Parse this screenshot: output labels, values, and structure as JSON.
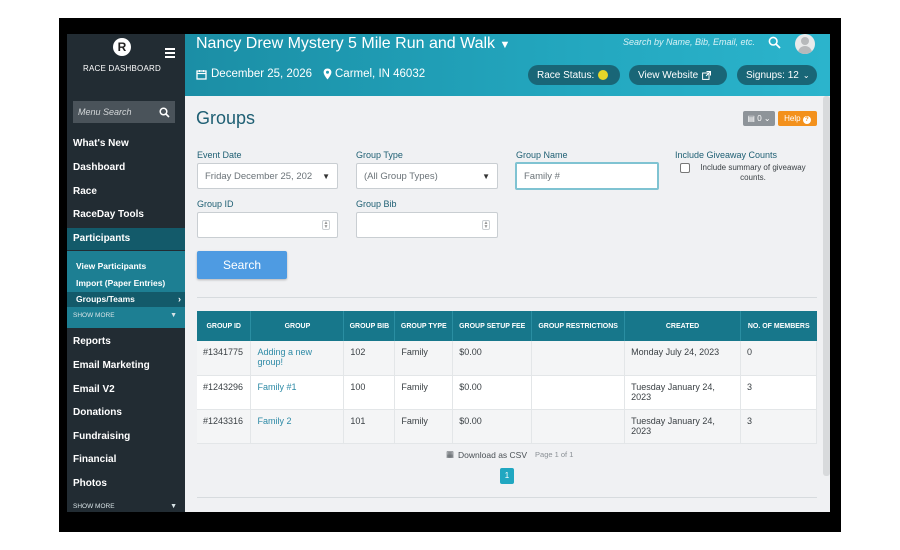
{
  "sidebar": {
    "logo_letter": "R",
    "logo_text": "RACE DASHBOARD",
    "menu_search_placeholder": "Menu Search",
    "items_top": [
      "What's New",
      "Dashboard",
      "Race",
      "RaceDay Tools"
    ],
    "active_item": "Participants",
    "sub_items": [
      "View Participants",
      "Import (Paper Entries)",
      "Groups/Teams"
    ],
    "show_more_1": "SHOW MORE",
    "items_bottom": [
      "Reports",
      "Email Marketing",
      "Email V2",
      "Donations",
      "Fundraising",
      "Financial",
      "Photos"
    ],
    "show_more_2": "SHOW MORE"
  },
  "header": {
    "event_title": "Nancy Drew Mystery 5 Mile Run and Walk",
    "search_placeholder": "Search by Name, Bib, Email, etc.",
    "date": "December 25, 2026",
    "location": "Carmel, IN 46032",
    "race_status_label": "Race Status:",
    "view_website_label": "View Website",
    "signups_label": "Signups: 12"
  },
  "main": {
    "title": "Groups",
    "count_button": "0",
    "help_button": "Help",
    "filters": {
      "event_date_label": "Event Date",
      "event_date_value": "Friday December 25, 202",
      "group_type_label": "Group Type",
      "group_type_value": "(All Group Types)",
      "group_name_label": "Group Name",
      "group_name_value": "Family #",
      "giveaway_label": "Include Giveaway Counts",
      "giveaway_desc": "Include summary of giveaway counts.",
      "group_id_label": "Group ID",
      "group_bib_label": "Group Bib"
    },
    "search_button": "Search"
  },
  "table": {
    "headers": [
      "GROUP ID",
      "GROUP",
      "GROUP BIB",
      "GROUP TYPE",
      "GROUP SETUP FEE",
      "GROUP RESTRICTIONS",
      "CREATED",
      "NO. OF MEMBERS"
    ],
    "rows": [
      {
        "id": "#1341775",
        "group": "Adding a new group!",
        "bib": "102",
        "type": "Family",
        "fee": "$0.00",
        "restrictions": "",
        "created": "Monday July 24, 2023",
        "members": "0"
      },
      {
        "id": "#1243296",
        "group": "Family #1",
        "bib": "100",
        "type": "Family",
        "fee": "$0.00",
        "restrictions": "",
        "created": "Tuesday January 24, 2023",
        "members": "3"
      },
      {
        "id": "#1243316",
        "group": "Family 2",
        "bib": "101",
        "type": "Family",
        "fee": "$0.00",
        "restrictions": "",
        "created": "Tuesday January 24, 2023",
        "members": "3"
      }
    ]
  },
  "footer": {
    "download_csv": "Download as CSV",
    "page_info": "Page 1 of 1",
    "current_page": "1"
  },
  "colors": {
    "header_teal": "#1b8ea5",
    "sidebar_bg": "#222c33",
    "table_header": "#17778b",
    "search_button": "#4e9be2",
    "help_button": "#f3911c"
  }
}
